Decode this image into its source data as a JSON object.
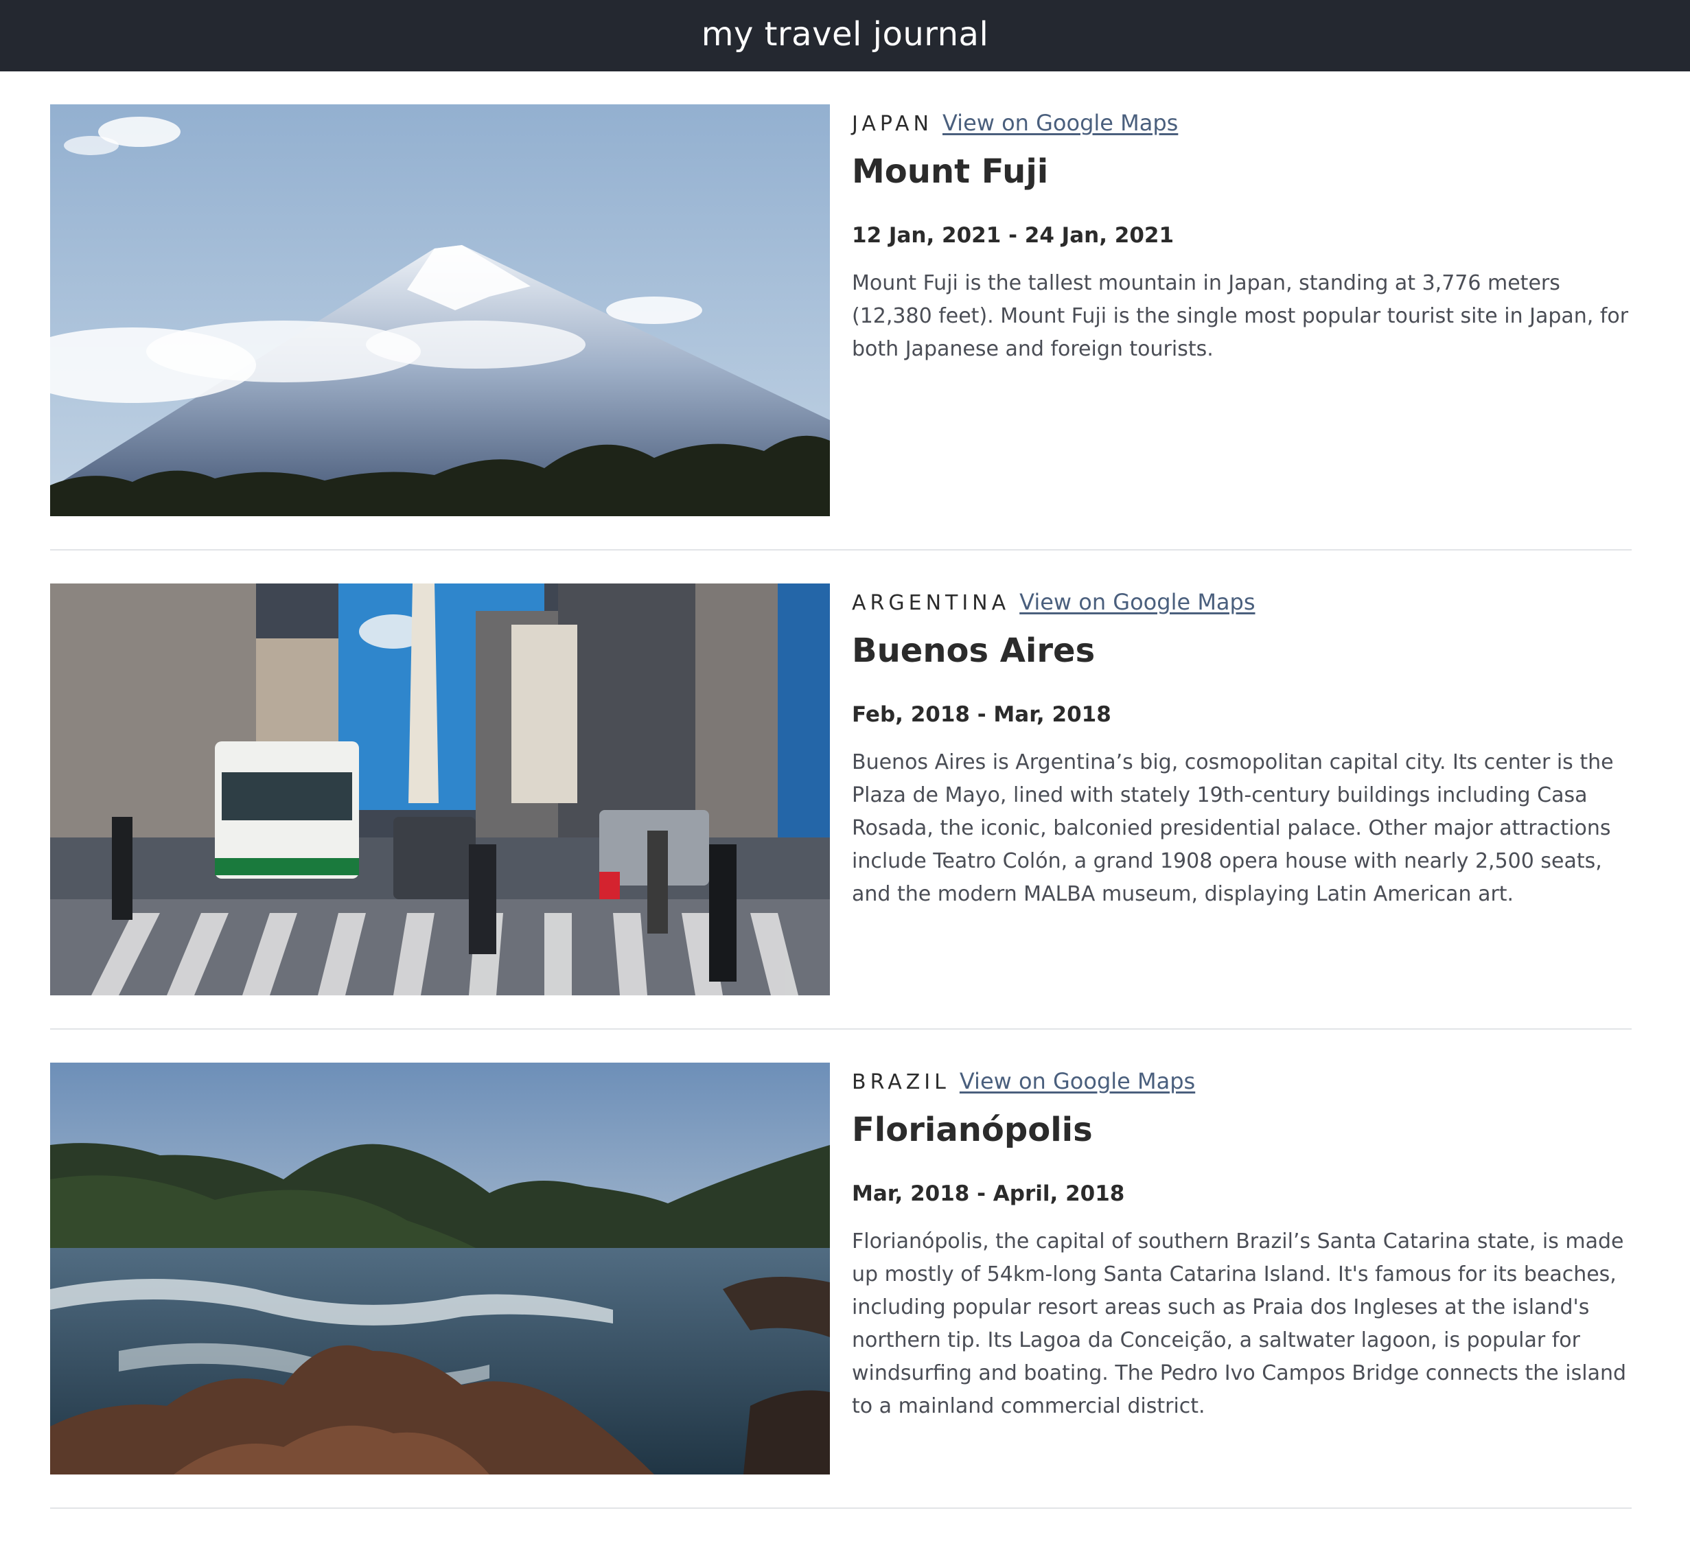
{
  "header": {
    "title": "my travel journal",
    "background": "#242830"
  },
  "entries": [
    {
      "country": "JAPAN",
      "map_link": "View on Google Maps",
      "title": "Mount Fuji",
      "dates": "12 Jan, 2021 - 24 Jan, 2021",
      "description": "Mount Fuji is the tallest mountain in Japan, standing at 3,776 meters (12,380 feet). Mount Fuji is the single most popular tourist site in Japan, for both Japanese and foreign tourists.",
      "photo": "mount-fuji-photo"
    },
    {
      "country": "ARGENTINA",
      "map_link": "View on Google Maps",
      "title": "Buenos Aires",
      "dates": "Feb, 2018 - Mar, 2018",
      "description": "Buenos Aires is Argentina’s big, cosmopolitan capital city. Its center is the Plaza de Mayo, lined with stately 19th-century buildings including Casa Rosada, the iconic, balconied presidential palace. Other major attractions include Teatro Colón, a grand 1908 opera house with nearly 2,500 seats, and the modern MALBA museum, displaying Latin American art.",
      "photo": "buenos-aires-street-photo"
    },
    {
      "country": "BRAZIL",
      "map_link": "View on Google Maps",
      "title": "Florianópolis",
      "dates": "Mar, 2018 - April, 2018",
      "description": "Florianópolis, the capital of southern Brazil’s Santa Catarina state, is made up mostly of 54km-long Santa Catarina Island. It's famous for its beaches, including popular resort areas such as Praia dos Ingleses at the island's northern tip. Its Lagoa da Conceição, a saltwater lagoon, is popular for windsurfing and boating. The Pedro Ivo Campos Bridge connects the island to a mainland commercial district.",
      "photo": "florianopolis-coast-photo"
    }
  ],
  "colors": {
    "link": "#4a5f7d",
    "heading": "#2b2b2b",
    "body_text": "#4a4d55",
    "divider": "#e2e4e7"
  }
}
